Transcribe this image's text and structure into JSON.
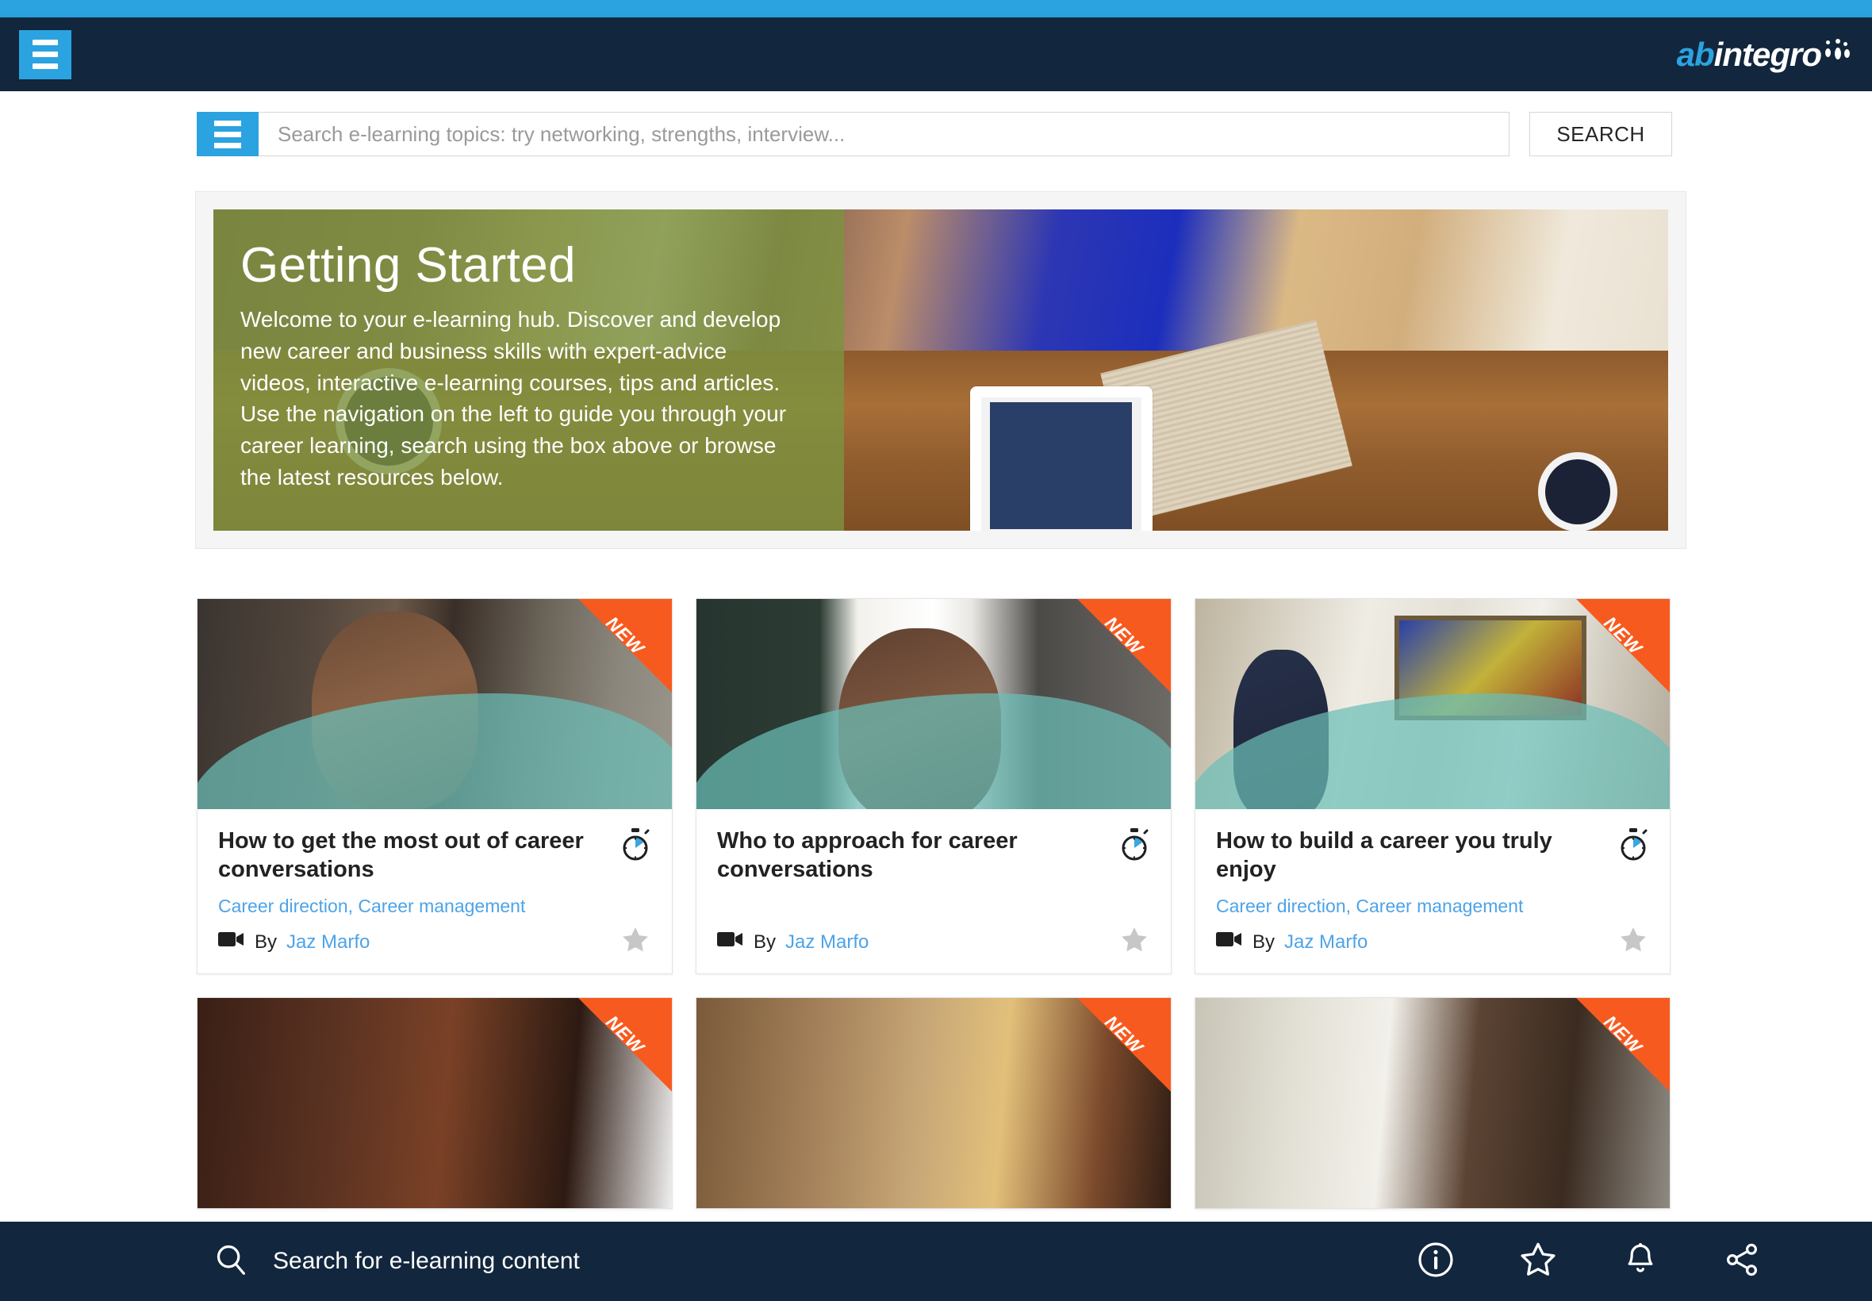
{
  "header": {
    "menu_icon": "hamburger-icon",
    "brand_ab": "ab",
    "brand_integro": "integro"
  },
  "search": {
    "menu_icon": "hamburger-icon",
    "placeholder": "Search e-learning topics: try networking, strengths, interview...",
    "value": "",
    "button_label": "SEARCH"
  },
  "hero": {
    "title": "Getting Started",
    "body": "Welcome to your e-learning hub. Discover and develop new career and business skills with expert-advice videos, interactive e-learning courses, tips and articles. Use the navigation on the left to guide you through your career learning, search using the box above or browse the latest resources below."
  },
  "badges": {
    "new_label": "NEW"
  },
  "labels": {
    "by": "By"
  },
  "colors": {
    "accent_blue": "#2ba3e0",
    "header_navy": "#12263d",
    "link_blue": "#4da3e8",
    "ribbon_orange": "#f75a1e",
    "hero_green": "#7c933f",
    "wave_teal": "#6bbeb7",
    "star_grey": "#c7c7c7"
  },
  "cards": [
    {
      "title": "How to get the most out of career conversations",
      "categories": "Career direction, Career management",
      "author": "Jaz Marfo",
      "is_new": true,
      "media_icon": "video-camera-icon",
      "duration_icon": "stopwatch-icon",
      "favourite_icon": "star-icon"
    },
    {
      "title": "Who to approach for career conversations",
      "categories": "",
      "author": "Jaz Marfo",
      "is_new": true,
      "media_icon": "video-camera-icon",
      "duration_icon": "stopwatch-icon",
      "favourite_icon": "star-icon"
    },
    {
      "title": "How to build a career you truly enjoy",
      "categories": "Career direction, Career management",
      "author": "Jaz Marfo",
      "is_new": true,
      "media_icon": "video-camera-icon",
      "duration_icon": "stopwatch-icon",
      "favourite_icon": "star-icon"
    }
  ],
  "cards_row2": [
    {
      "is_new": true
    },
    {
      "is_new": true
    },
    {
      "is_new": true
    }
  ],
  "footer": {
    "search_icon": "search-icon",
    "search_label": "Search for e-learning content",
    "icons": [
      {
        "name": "info-icon"
      },
      {
        "name": "star-icon"
      },
      {
        "name": "bell-icon"
      },
      {
        "name": "share-icon"
      }
    ]
  }
}
